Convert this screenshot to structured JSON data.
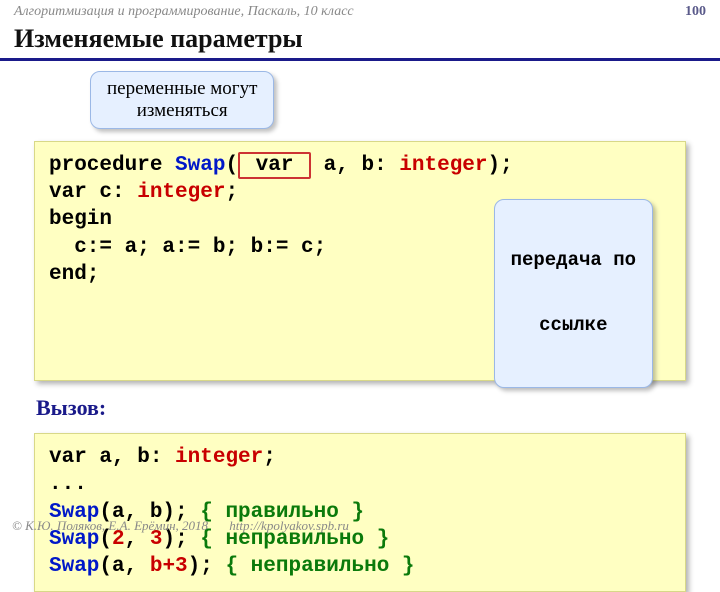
{
  "header": {
    "course": "Алгоритмизация и программирование, Паскаль, 10 класс",
    "page": "100"
  },
  "title": "Изменяемые параметры",
  "callout1": {
    "line1": "переменные могут",
    "line2": "изменяться"
  },
  "callout2": {
    "line1": "передача по",
    "line2": "ссылке"
  },
  "code1": {
    "l1a": "procedure ",
    "l1b": "Swap",
    "l1c": "(",
    "l1d": " var ",
    "l1e": " a, b: ",
    "l1f": "integer",
    "l1g": ");",
    "l2a": "var c: ",
    "l2b": "integer",
    "l2c": ";",
    "l3": "begin",
    "l4": "  c:= a; a:= b; b:= c;",
    "l5": "end;"
  },
  "call_label": "Вызов:",
  "code2": {
    "l1a": "var a, b: ",
    "l1b": "integer",
    "l1c": ";",
    "l2": "...",
    "l3a": "Swap",
    "l3b": "(a, b); ",
    "l3c": "{ правильно }",
    "l4a": "Swap",
    "l4b": "(",
    "l4c": "2",
    "l4d": ", ",
    "l4e": "3",
    "l4f": "); ",
    "l4g": "{ неправильно }",
    "l5a": "Swap",
    "l5b": "(a, ",
    "l5c": "b+3",
    "l5d": "); ",
    "l5e": "{ неправильно }"
  },
  "footer": {
    "copyright": "© К.Ю. Поляков, Е.А. Ерёмин, 2018",
    "url": "http://kpolyakov.spb.ru"
  }
}
